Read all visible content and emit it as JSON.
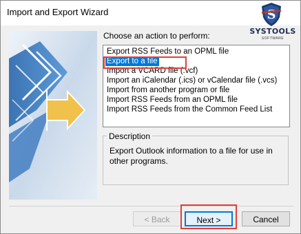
{
  "window": {
    "title": "Import and Export Wizard"
  },
  "logo": {
    "brand": "SYSTOOLS",
    "sub": "SOFTWARE",
    "mark": "S"
  },
  "prompt": "Choose an action to perform:",
  "actions": [
    {
      "label": "Export RSS Feeds to an OPML file",
      "selected": false
    },
    {
      "label": "Export to a file",
      "selected": true
    },
    {
      "label": "Import a VCARD file (.vcf)",
      "selected": false
    },
    {
      "label": "Import an iCalendar (.ics) or vCalendar file (.vcs)",
      "selected": false
    },
    {
      "label": "Import from another program or file",
      "selected": false
    },
    {
      "label": "Import RSS Feeds from an OPML file",
      "selected": false
    },
    {
      "label": "Import RSS Feeds from the Common Feed List",
      "selected": false
    }
  ],
  "description": {
    "label": "Description",
    "text": "Export Outlook information to a file for use in other programs."
  },
  "buttons": {
    "back": "< Back",
    "next": "Next >",
    "cancel": "Cancel"
  },
  "colors": {
    "selection": "#0078d7",
    "highlight": "#e0403a"
  }
}
